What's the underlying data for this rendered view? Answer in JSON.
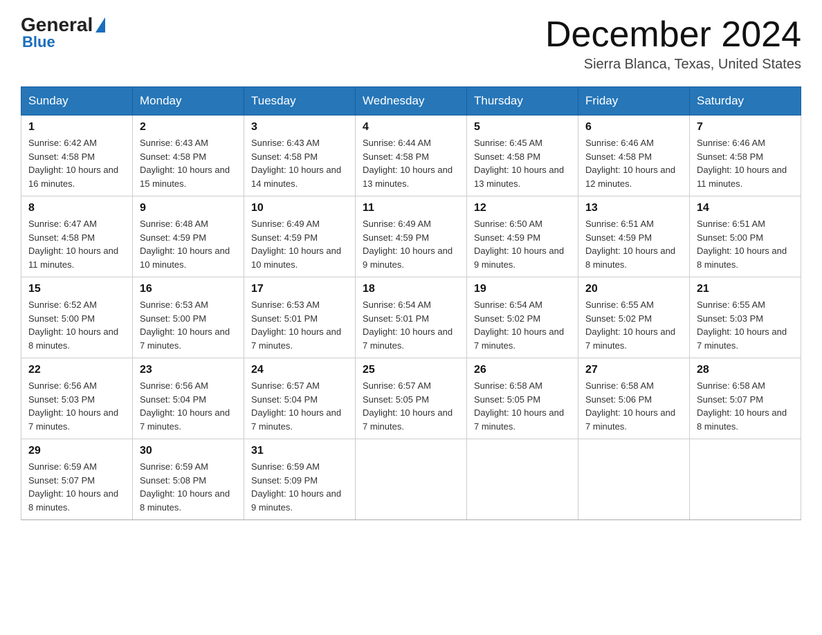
{
  "header": {
    "logo_line1": "General",
    "logo_line2": "Blue",
    "month_title": "December 2024",
    "location": "Sierra Blanca, Texas, United States"
  },
  "days_of_week": [
    "Sunday",
    "Monday",
    "Tuesday",
    "Wednesday",
    "Thursday",
    "Friday",
    "Saturday"
  ],
  "weeks": [
    [
      {
        "day": "1",
        "sunrise": "6:42 AM",
        "sunset": "4:58 PM",
        "daylight": "10 hours and 16 minutes."
      },
      {
        "day": "2",
        "sunrise": "6:43 AM",
        "sunset": "4:58 PM",
        "daylight": "10 hours and 15 minutes."
      },
      {
        "day": "3",
        "sunrise": "6:43 AM",
        "sunset": "4:58 PM",
        "daylight": "10 hours and 14 minutes."
      },
      {
        "day": "4",
        "sunrise": "6:44 AM",
        "sunset": "4:58 PM",
        "daylight": "10 hours and 13 minutes."
      },
      {
        "day": "5",
        "sunrise": "6:45 AM",
        "sunset": "4:58 PM",
        "daylight": "10 hours and 13 minutes."
      },
      {
        "day": "6",
        "sunrise": "6:46 AM",
        "sunset": "4:58 PM",
        "daylight": "10 hours and 12 minutes."
      },
      {
        "day": "7",
        "sunrise": "6:46 AM",
        "sunset": "4:58 PM",
        "daylight": "10 hours and 11 minutes."
      }
    ],
    [
      {
        "day": "8",
        "sunrise": "6:47 AM",
        "sunset": "4:58 PM",
        "daylight": "10 hours and 11 minutes."
      },
      {
        "day": "9",
        "sunrise": "6:48 AM",
        "sunset": "4:59 PM",
        "daylight": "10 hours and 10 minutes."
      },
      {
        "day": "10",
        "sunrise": "6:49 AM",
        "sunset": "4:59 PM",
        "daylight": "10 hours and 10 minutes."
      },
      {
        "day": "11",
        "sunrise": "6:49 AM",
        "sunset": "4:59 PM",
        "daylight": "10 hours and 9 minutes."
      },
      {
        "day": "12",
        "sunrise": "6:50 AM",
        "sunset": "4:59 PM",
        "daylight": "10 hours and 9 minutes."
      },
      {
        "day": "13",
        "sunrise": "6:51 AM",
        "sunset": "4:59 PM",
        "daylight": "10 hours and 8 minutes."
      },
      {
        "day": "14",
        "sunrise": "6:51 AM",
        "sunset": "5:00 PM",
        "daylight": "10 hours and 8 minutes."
      }
    ],
    [
      {
        "day": "15",
        "sunrise": "6:52 AM",
        "sunset": "5:00 PM",
        "daylight": "10 hours and 8 minutes."
      },
      {
        "day": "16",
        "sunrise": "6:53 AM",
        "sunset": "5:00 PM",
        "daylight": "10 hours and 7 minutes."
      },
      {
        "day": "17",
        "sunrise": "6:53 AM",
        "sunset": "5:01 PM",
        "daylight": "10 hours and 7 minutes."
      },
      {
        "day": "18",
        "sunrise": "6:54 AM",
        "sunset": "5:01 PM",
        "daylight": "10 hours and 7 minutes."
      },
      {
        "day": "19",
        "sunrise": "6:54 AM",
        "sunset": "5:02 PM",
        "daylight": "10 hours and 7 minutes."
      },
      {
        "day": "20",
        "sunrise": "6:55 AM",
        "sunset": "5:02 PM",
        "daylight": "10 hours and 7 minutes."
      },
      {
        "day": "21",
        "sunrise": "6:55 AM",
        "sunset": "5:03 PM",
        "daylight": "10 hours and 7 minutes."
      }
    ],
    [
      {
        "day": "22",
        "sunrise": "6:56 AM",
        "sunset": "5:03 PM",
        "daylight": "10 hours and 7 minutes."
      },
      {
        "day": "23",
        "sunrise": "6:56 AM",
        "sunset": "5:04 PM",
        "daylight": "10 hours and 7 minutes."
      },
      {
        "day": "24",
        "sunrise": "6:57 AM",
        "sunset": "5:04 PM",
        "daylight": "10 hours and 7 minutes."
      },
      {
        "day": "25",
        "sunrise": "6:57 AM",
        "sunset": "5:05 PM",
        "daylight": "10 hours and 7 minutes."
      },
      {
        "day": "26",
        "sunrise": "6:58 AM",
        "sunset": "5:05 PM",
        "daylight": "10 hours and 7 minutes."
      },
      {
        "day": "27",
        "sunrise": "6:58 AM",
        "sunset": "5:06 PM",
        "daylight": "10 hours and 7 minutes."
      },
      {
        "day": "28",
        "sunrise": "6:58 AM",
        "sunset": "5:07 PM",
        "daylight": "10 hours and 8 minutes."
      }
    ],
    [
      {
        "day": "29",
        "sunrise": "6:59 AM",
        "sunset": "5:07 PM",
        "daylight": "10 hours and 8 minutes."
      },
      {
        "day": "30",
        "sunrise": "6:59 AM",
        "sunset": "5:08 PM",
        "daylight": "10 hours and 8 minutes."
      },
      {
        "day": "31",
        "sunrise": "6:59 AM",
        "sunset": "5:09 PM",
        "daylight": "10 hours and 9 minutes."
      },
      null,
      null,
      null,
      null
    ]
  ],
  "labels": {
    "sunrise_prefix": "Sunrise: ",
    "sunset_prefix": "Sunset: ",
    "daylight_prefix": "Daylight: "
  }
}
